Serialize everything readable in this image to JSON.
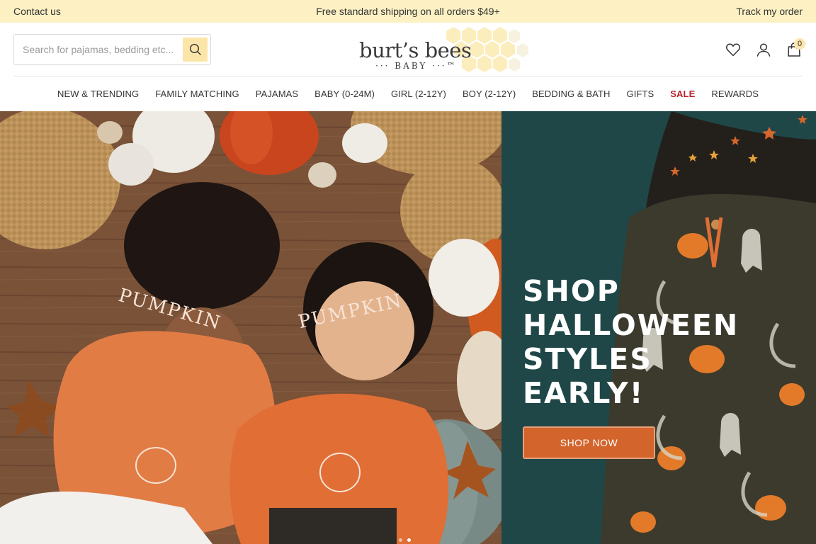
{
  "promo_bar": {
    "contact_label": "Contact us",
    "shipping_text": "Free standard shipping on all orders $49+",
    "track_label": "Track my order"
  },
  "header": {
    "search": {
      "placeholder": "Search for pajamas, bedding etc...",
      "value": ""
    },
    "logo": {
      "main": "burt’s bees",
      "sub": "··· BABY ···™"
    },
    "cart_count": "0",
    "icons": [
      "search-icon",
      "heart-icon",
      "user-icon",
      "shopping-bag-icon"
    ]
  },
  "nav": {
    "items": [
      {
        "label": "NEW & TRENDING"
      },
      {
        "label": "FAMILY MATCHING"
      },
      {
        "label": "PAJAMAS"
      },
      {
        "label": "BABY (0-24M)"
      },
      {
        "label": "GIRL (2-12Y)"
      },
      {
        "label": "BOY (2-12Y)"
      },
      {
        "label": "BEDDING & BATH"
      },
      {
        "label": "GIFTS"
      },
      {
        "label": "SALE"
      },
      {
        "label": "REWARDS"
      }
    ]
  },
  "hero": {
    "headline": [
      "SHOP",
      "HALLOWEEN",
      "STYLES",
      "EARLY!"
    ],
    "shirt_text": "PUMPKIN",
    "cta_label": "SHOP NOW",
    "carousel": {
      "slides": 2,
      "active": 2
    }
  },
  "colors": {
    "promo_bg": "#fdf1c4",
    "accent_yellow": "#fbe5a8",
    "sale_red": "#b81f2e",
    "cta_orange": "#d2642c",
    "hero_teal": "#1f4748"
  }
}
